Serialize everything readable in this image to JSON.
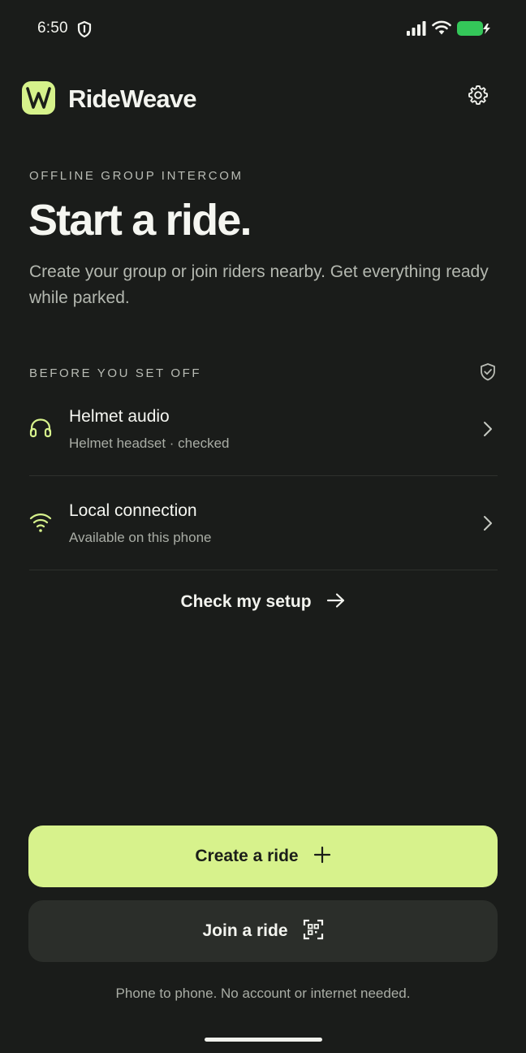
{
  "status_bar": {
    "time": "6:50"
  },
  "header": {
    "app_name": "RideWeave",
    "logo_letter": "W"
  },
  "hero": {
    "eyebrow": "OFFLINE GROUP INTERCOM",
    "title": "Start a ride.",
    "subtitle": "Create your group or join riders nearby. Get everything ready while parked."
  },
  "checklist": {
    "label": "BEFORE YOU SET OFF",
    "items": [
      {
        "title": "Helmet audio",
        "subtitle": "Helmet headset · checked",
        "icon": "headphones-icon"
      },
      {
        "title": "Local connection",
        "subtitle": "Available on this phone",
        "icon": "wifi-icon"
      }
    ],
    "check_link": "Check my setup"
  },
  "actions": {
    "create_label": "Create a ride",
    "join_label": "Join a ride"
  },
  "footnote": "Phone to phone. No account or internet needed.",
  "colors": {
    "background": "#1a1c1a",
    "accent": "#d7f28c",
    "secondary_button": "#2b2e2a",
    "battery": "#34c759"
  }
}
